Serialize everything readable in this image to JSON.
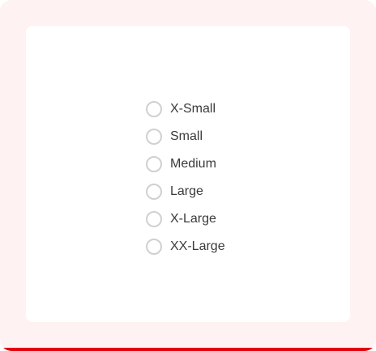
{
  "size_options": [
    {
      "label": "X-Small"
    },
    {
      "label": "Small"
    },
    {
      "label": "Medium"
    },
    {
      "label": "Large"
    },
    {
      "label": "X-Large"
    },
    {
      "label": "XX-Large"
    }
  ],
  "colors": {
    "frame_background": "#fef3f2",
    "accent": "#e3000f",
    "card_background": "#ffffff",
    "radio_border": "#d0d0d0",
    "label_text": "#3a3a3a"
  }
}
